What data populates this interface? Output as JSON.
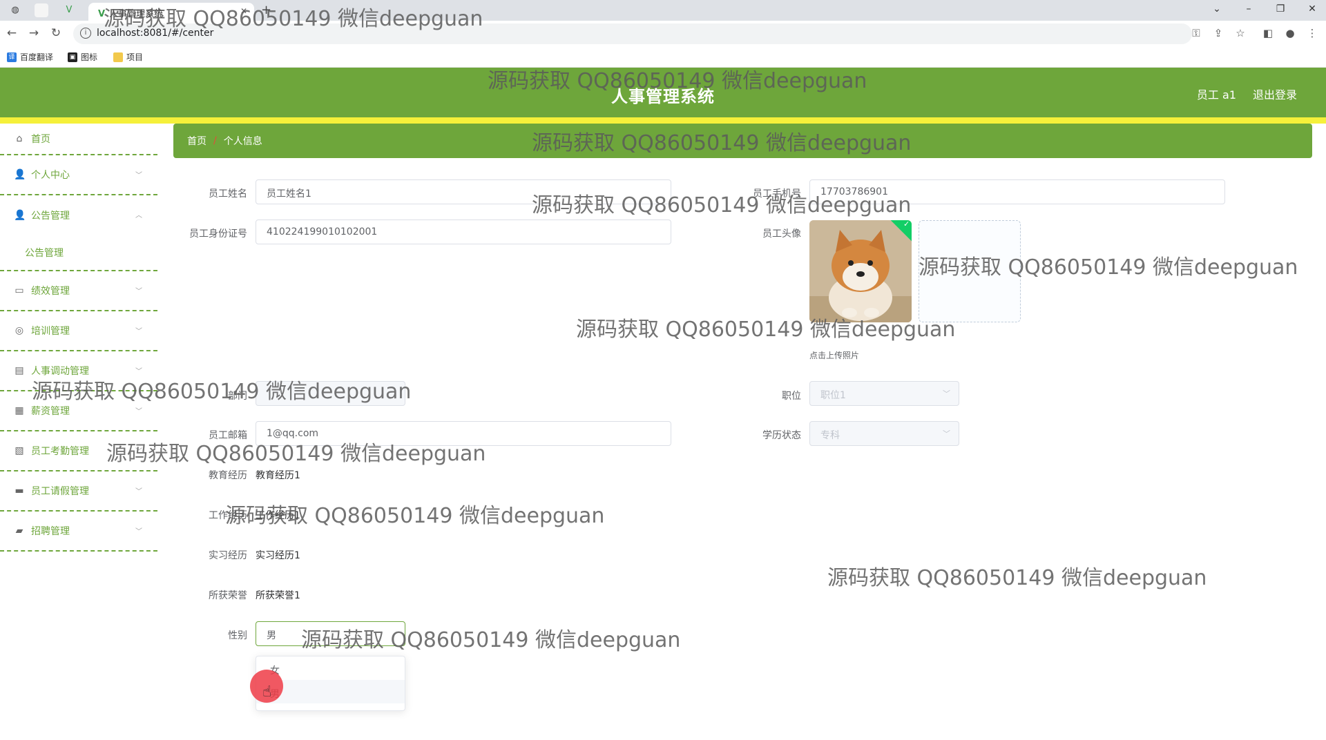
{
  "browser": {
    "tab_title": "人事管理系统",
    "url": "localhost:8081/#/center",
    "bookmarks": [
      "百度翻译",
      "图标",
      "项目"
    ]
  },
  "header": {
    "title": "人事管理系统",
    "user": "员工 a1",
    "logout": "退出登录",
    "colors": {
      "header": "#6ea63b",
      "accent_bar": "#f5f03a"
    }
  },
  "sidebar": {
    "home": "首页",
    "items": [
      {
        "label": "个人中心",
        "icon": "user-icon"
      },
      {
        "label": "公告管理",
        "icon": "user-icon",
        "expanded": true,
        "children": [
          "公告管理"
        ]
      },
      {
        "label": "绩效管理",
        "icon": "message-icon"
      },
      {
        "label": "培训管理",
        "icon": "compass-icon"
      },
      {
        "label": "人事调动管理",
        "icon": "clipboard-icon"
      },
      {
        "label": "薪资管理",
        "icon": "grid-icon"
      },
      {
        "label": "员工考勤管理",
        "icon": "chart-icon"
      },
      {
        "label": "员工请假管理",
        "icon": "chat-icon"
      },
      {
        "label": "招聘管理",
        "icon": "briefcase-icon"
      }
    ]
  },
  "breadcrumb": {
    "home": "首页",
    "separator": "/",
    "current": "个人信息"
  },
  "form": {
    "name_label": "员工姓名",
    "name_value": "员工姓名1",
    "phone_label": "员工手机号",
    "phone_value": "17703786901",
    "idcard_label": "员工身份证号",
    "idcard_value": "410224199010102001",
    "avatar_label": "员工头像",
    "upload_tip": "点击上传照片",
    "dept_label": "部门",
    "position_label": "职位",
    "position_value": "职位1",
    "email_label": "员工邮箱",
    "email_value": "1@qq.com",
    "edu_status_label": "学历状态",
    "edu_status_value": "专科",
    "edu_exp_label": "教育经历",
    "edu_exp_value": "教育经历1",
    "work_exp_label": "工作经历",
    "work_exp_value": "工作经历1",
    "intern_label": "实习经历",
    "intern_value": "实习经历1",
    "honor_label": "所获荣誉",
    "honor_value": "所获荣誉1",
    "gender_label": "性别",
    "gender_value": "男",
    "gender_options": [
      "女",
      "男"
    ]
  },
  "watermark": "源码获取 QQ86050149 微信deepguan"
}
